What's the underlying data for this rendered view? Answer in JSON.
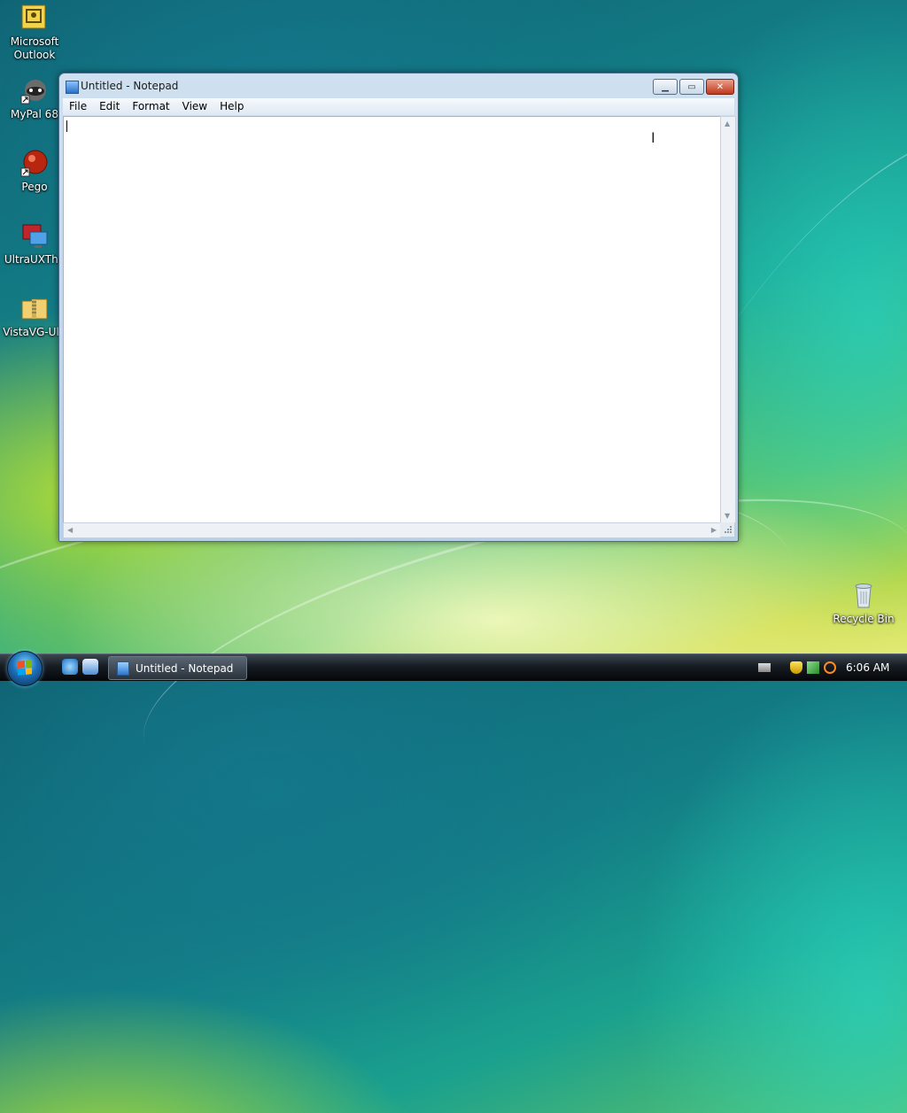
{
  "desktop": {
    "icons": [
      {
        "label_lines": [
          "Microsoft",
          "Outlook"
        ]
      },
      {
        "label_lines": [
          "MyPal 68"
        ]
      },
      {
        "label_lines": [
          "Pego"
        ]
      },
      {
        "label_lines": [
          "UltraUXThe"
        ]
      },
      {
        "label_lines": [
          "VistaVG-Ulti"
        ]
      },
      {
        "label_lines": [
          "Recycle Bin"
        ]
      }
    ]
  },
  "window": {
    "title": "Untitled - Notepad",
    "menu": [
      "File",
      "Edit",
      "Format",
      "View",
      "Help"
    ],
    "content": ""
  },
  "taskbar": {
    "task_button_label": "Untitled - Notepad",
    "clock": "6:06 AM"
  }
}
